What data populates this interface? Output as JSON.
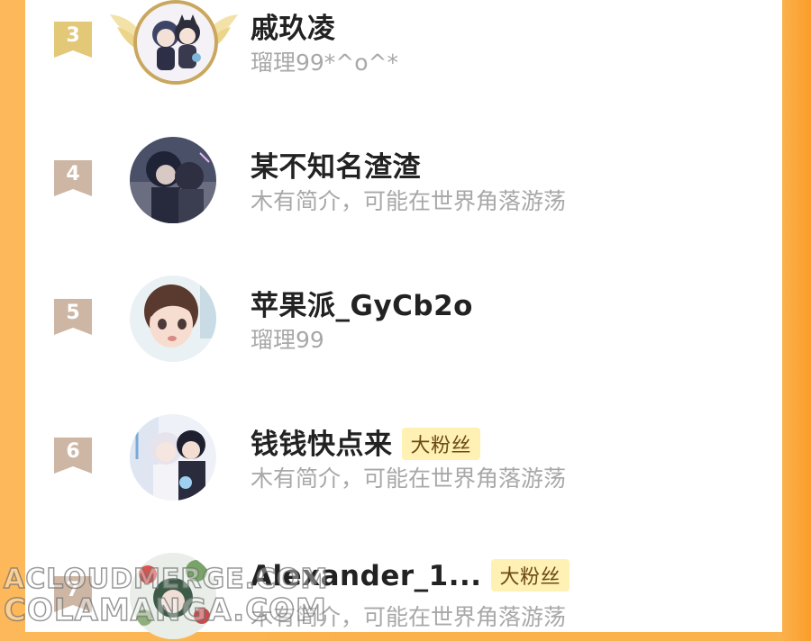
{
  "ranking": {
    "entries": [
      {
        "rank": "3",
        "name": "戚玖凌",
        "bio": "瑠理99*^o^*",
        "badge": ""
      },
      {
        "rank": "4",
        "name": "某不知名渣渣",
        "bio": "木有简介，可能在世界角落游荡",
        "badge": ""
      },
      {
        "rank": "5",
        "name": "苹果派_GyCb2o",
        "bio": "瑠理99",
        "badge": ""
      },
      {
        "rank": "6",
        "name": "钱钱快点来",
        "bio": "木有简介，可能在世界角落游荡",
        "badge": "大粉丝"
      },
      {
        "rank": "7",
        "name": "Alexander_1...",
        "bio": "木有简介，可能在世界角落游荡",
        "badge": "大粉丝"
      }
    ]
  },
  "watermark": {
    "line1": "ACLOUDMERGE.COM",
    "line2": "COLAMANGA.COM"
  },
  "colors": {
    "background": "#fbb14c",
    "gold_flag": "#e2c877",
    "flag": "#cdb6a4",
    "badge_bg": "#fff0b3"
  }
}
